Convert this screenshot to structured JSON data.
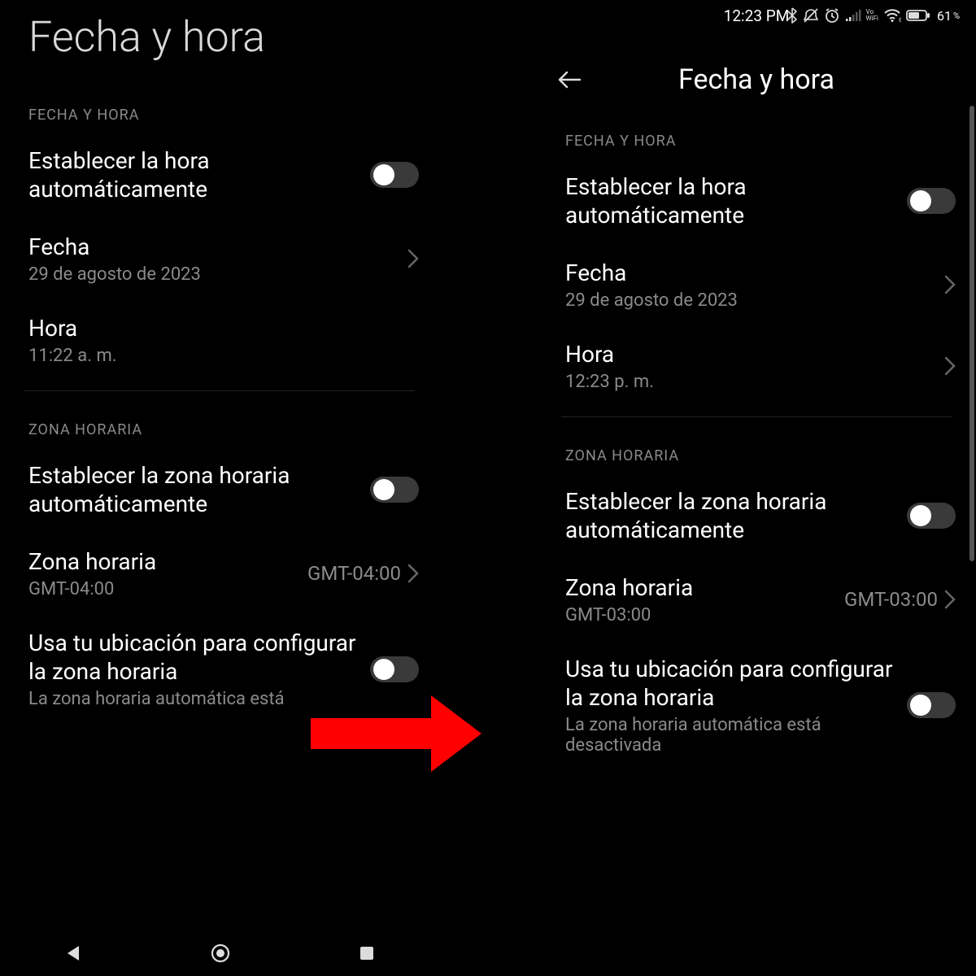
{
  "colors": {
    "arrow": "#ff0000",
    "muted": "#8a8a8a"
  },
  "left": {
    "big_title": "Fecha y hora",
    "section1": "FECHA Y HORA",
    "auto_time_label": "Establecer la hora automáticamente",
    "date_label": "Fecha",
    "date_value": "29 de agosto de 2023",
    "time_label": "Hora",
    "time_value": "11:22 a. m.",
    "section2": "ZONA HORARIA",
    "auto_tz_label": "Establecer la zona horaria automáticamente",
    "tz_label": "Zona horaria",
    "tz_sub": "GMT-04:00",
    "tz_trail": "GMT-04:00",
    "loc_tz_label": "Usa tu ubicación para configurar la zona horaria",
    "loc_tz_sub": "La zona horaria automática está"
  },
  "right": {
    "status_time": "12:23 PM",
    "battery_pct": "61",
    "battery_sym": "%",
    "vowifi": "Vo\nWiFi",
    "page_title": "Fecha y hora",
    "section1": "FECHA Y HORA",
    "auto_time_label": "Establecer la hora automáticamente",
    "date_label": "Fecha",
    "date_value": "29 de agosto de 2023",
    "time_label": "Hora",
    "time_value": "12:23 p. m.",
    "section2": "ZONA HORARIA",
    "auto_tz_label": "Establecer la zona horaria automáticamente",
    "tz_label": "Zona horaria",
    "tz_sub": "GMT-03:00",
    "tz_trail": "GMT-03:00",
    "loc_tz_label": "Usa tu ubicación para configurar la zona horaria",
    "loc_tz_sub": "La zona horaria automática está desactivada"
  }
}
